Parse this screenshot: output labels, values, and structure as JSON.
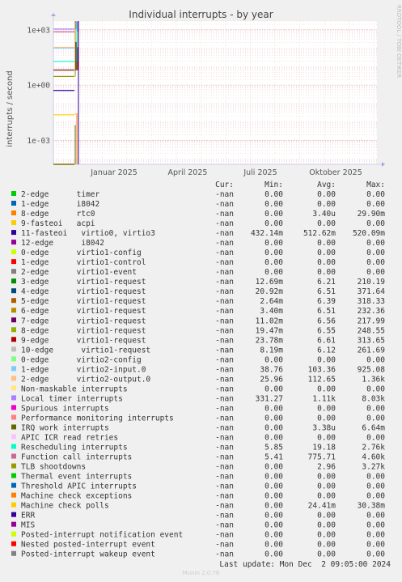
{
  "chart_data": {
    "type": "line",
    "title": "Individual interrupts - by year",
    "ylabel": "interrupts / second",
    "y_scale": "log",
    "ylim": [
      5e-05,
      3000
    ],
    "y_ticks": [
      {
        "value": 1000,
        "label": "1e+03"
      },
      {
        "value": 1,
        "label": "1e+00"
      },
      {
        "value": 0.001,
        "label": "1e-03"
      }
    ],
    "x_ticks": [
      "Januar 2025",
      "April 2025",
      "Juli 2025",
      "Oktober 2025"
    ],
    "grid": true,
    "columns": [
      "Cur:",
      "Min:",
      "Avg:",
      "Max:"
    ],
    "series": [
      {
        "name": "2-edge      timer",
        "color": "#00cc00",
        "cur": "-nan",
        "min": "0.00",
        "avg": "0.00",
        "max": "0.00"
      },
      {
        "name": "1-edge      i8042",
        "color": "#0066b3",
        "cur": "-nan",
        "min": "0.00",
        "avg": "0.00",
        "max": "0.00"
      },
      {
        "name": "8-edge      rtc0",
        "color": "#ff8000",
        "cur": "-nan",
        "min": "0.00",
        "avg": "3.40u",
        "max": "29.90m"
      },
      {
        "name": "9-fasteoi   acpi",
        "color": "#ffcc00",
        "cur": "-nan",
        "min": "0.00",
        "avg": "0.00",
        "max": "0.00"
      },
      {
        "name": "11-fasteoi   virtio0, virtio3",
        "color": "#330099",
        "cur": "-nan",
        "min": "432.14m",
        "avg": "512.62m",
        "max": "520.09m"
      },
      {
        "name": "12-edge      i8042",
        "color": "#990099",
        "cur": "-nan",
        "min": "0.00",
        "avg": "0.00",
        "max": "0.00"
      },
      {
        "name": "0-edge      virtio1-config",
        "color": "#ccff00",
        "cur": "-nan",
        "min": "0.00",
        "avg": "0.00",
        "max": "0.00"
      },
      {
        "name": "1-edge      virtio1-control",
        "color": "#ff0000",
        "cur": "-nan",
        "min": "0.00",
        "avg": "0.00",
        "max": "0.00"
      },
      {
        "name": "2-edge      virtio1-event",
        "color": "#808080",
        "cur": "-nan",
        "min": "0.00",
        "avg": "0.00",
        "max": "0.00"
      },
      {
        "name": "3-edge      virtio1-request",
        "color": "#008f00",
        "cur": "-nan",
        "min": "12.69m",
        "avg": "6.21",
        "max": "210.19"
      },
      {
        "name": "4-edge      virtio1-request",
        "color": "#00487d",
        "cur": "-nan",
        "min": "20.92m",
        "avg": "6.51",
        "max": "371.64"
      },
      {
        "name": "5-edge      virtio1-request",
        "color": "#b35a00",
        "cur": "-nan",
        "min": "2.64m",
        "avg": "6.39",
        "max": "318.33"
      },
      {
        "name": "6-edge      virtio1-request",
        "color": "#b38f00",
        "cur": "-nan",
        "min": "3.40m",
        "avg": "6.51",
        "max": "232.36"
      },
      {
        "name": "7-edge      virtio1-request",
        "color": "#6b006b",
        "cur": "-nan",
        "min": "11.02m",
        "avg": "6.56",
        "max": "217.99"
      },
      {
        "name": "8-edge      virtio1-request",
        "color": "#8fb300",
        "cur": "-nan",
        "min": "19.47m",
        "avg": "6.55",
        "max": "248.55"
      },
      {
        "name": "9-edge      virtio1-request",
        "color": "#b30000",
        "cur": "-nan",
        "min": "23.78m",
        "avg": "6.61",
        "max": "313.65"
      },
      {
        "name": "10-edge      virtio1-request",
        "color": "#bebebe",
        "cur": "-nan",
        "min": "8.19m",
        "avg": "6.12",
        "max": "261.69"
      },
      {
        "name": "0-edge      virtio2-config",
        "color": "#80ff80",
        "cur": "-nan",
        "min": "0.00",
        "avg": "0.00",
        "max": "0.00"
      },
      {
        "name": "1-edge      virtio2-input.0",
        "color": "#80c9ff",
        "cur": "-nan",
        "min": "38.76",
        "avg": "103.36",
        "max": "925.08"
      },
      {
        "name": "2-edge      virtio2-output.0",
        "color": "#ffc080",
        "cur": "-nan",
        "min": "25.96",
        "avg": "112.65",
        "max": "1.36k"
      },
      {
        "name": "Non-maskable interrupts",
        "color": "#ffe680",
        "cur": "-nan",
        "min": "0.00",
        "avg": "0.00",
        "max": "0.00"
      },
      {
        "name": "Local timer interrupts",
        "color": "#aa80ff",
        "cur": "-nan",
        "min": "331.27",
        "avg": "1.11k",
        "max": "8.03k"
      },
      {
        "name": "Spurious interrupts",
        "color": "#ee00cc",
        "cur": "-nan",
        "min": "0.00",
        "avg": "0.00",
        "max": "0.00"
      },
      {
        "name": "Performance monitoring interrupts",
        "color": "#ff8080",
        "cur": "-nan",
        "min": "0.00",
        "avg": "0.00",
        "max": "0.00"
      },
      {
        "name": "IRQ work interrupts",
        "color": "#666600",
        "cur": "-nan",
        "min": "0.00",
        "avg": "3.38u",
        "max": "6.64m"
      },
      {
        "name": "APIC ICR read retries",
        "color": "#ffbfff",
        "cur": "-nan",
        "min": "0.00",
        "avg": "0.00",
        "max": "0.00"
      },
      {
        "name": "Rescheduling interrupts",
        "color": "#00ffcc",
        "cur": "-nan",
        "min": "5.85",
        "avg": "19.18",
        "max": "2.76k"
      },
      {
        "name": "Function call interrupts",
        "color": "#cc6699",
        "cur": "-nan",
        "min": "5.41",
        "avg": "775.71",
        "max": "4.60k"
      },
      {
        "name": "TLB shootdowns",
        "color": "#999900",
        "cur": "-nan",
        "min": "0.00",
        "avg": "2.96",
        "max": "3.27k"
      },
      {
        "name": "Thermal event interrupts",
        "color": "#00cc00",
        "cur": "-nan",
        "min": "0.00",
        "avg": "0.00",
        "max": "0.00"
      },
      {
        "name": "Threshold APIC interrupts",
        "color": "#0066b3",
        "cur": "-nan",
        "min": "0.00",
        "avg": "0.00",
        "max": "0.00"
      },
      {
        "name": "Machine check exceptions",
        "color": "#ff8000",
        "cur": "-nan",
        "min": "0.00",
        "avg": "0.00",
        "max": "0.00"
      },
      {
        "name": "Machine check polls",
        "color": "#ffcc00",
        "cur": "-nan",
        "min": "0.00",
        "avg": "24.41m",
        "max": "30.38m"
      },
      {
        "name": "ERR",
        "color": "#330099",
        "cur": "-nan",
        "min": "0.00",
        "avg": "0.00",
        "max": "0.00"
      },
      {
        "name": "MIS",
        "color": "#990099",
        "cur": "-nan",
        "min": "0.00",
        "avg": "0.00",
        "max": "0.00"
      },
      {
        "name": "Posted-interrupt notification event",
        "color": "#ccff00",
        "cur": "-nan",
        "min": "0.00",
        "avg": "0.00",
        "max": "0.00"
      },
      {
        "name": "Nested posted-interrupt event",
        "color": "#ff0000",
        "cur": "-nan",
        "min": "0.00",
        "avg": "0.00",
        "max": "0.00"
      },
      {
        "name": "Posted-interrupt wakeup event",
        "color": "#808080",
        "cur": "-nan",
        "min": "0.00",
        "avg": "0.00",
        "max": "0.00"
      }
    ],
    "last_update": "Last update: Mon Dec  2 09:05:00 2024"
  },
  "watermark": "RRDTOOL / TOBI OETIKER",
  "footer": "Munin 2.0.76"
}
